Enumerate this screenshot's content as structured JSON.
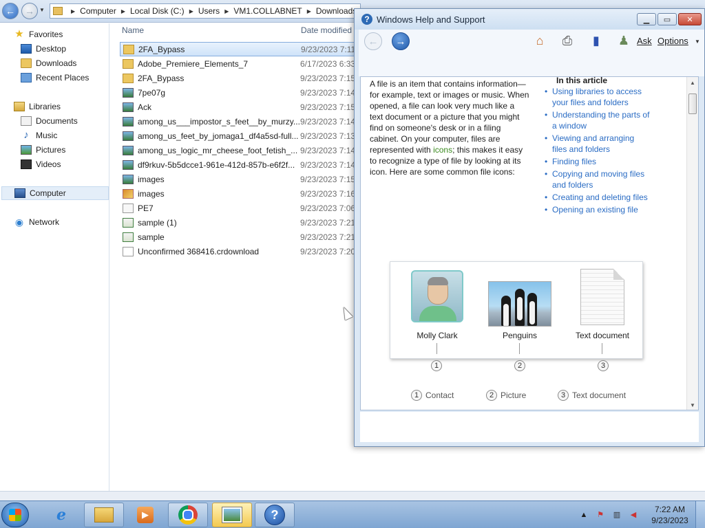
{
  "explorer": {
    "breadcrumbs": [
      "Computer",
      "Local Disk (C:)",
      "Users",
      "VM1.COLLABNET",
      "Downloads"
    ],
    "columns": {
      "name": "Name",
      "date_modified": "Date modified"
    },
    "nav": {
      "favorites": "Favorites",
      "desktop": "Desktop",
      "downloads": "Downloads",
      "recent_places": "Recent Places",
      "libraries": "Libraries",
      "documents": "Documents",
      "music": "Music",
      "pictures": "Pictures",
      "videos": "Videos",
      "computer": "Computer",
      "network": "Network"
    },
    "files": [
      {
        "name": "2FA_Bypass",
        "date": "9/23/2023 7:11",
        "icon": "folder-icon",
        "selected": true
      },
      {
        "name": "Adobe_Premiere_Elements_7",
        "date": "6/17/2023 6:33",
        "icon": "folder-icon"
      },
      {
        "name": "2FA_Bypass",
        "date": "9/23/2023 7:15",
        "icon": "folder-icon"
      },
      {
        "name": "7pe07g",
        "date": "9/23/2023 7:14",
        "icon": "image-file-icon"
      },
      {
        "name": "Ack",
        "date": "9/23/2023 7:15",
        "icon": "image-file-icon"
      },
      {
        "name": "among_us___impostor_s_feet__by_murzy...",
        "date": "9/23/2023 7:14",
        "icon": "image-file-icon"
      },
      {
        "name": "among_us_feet_by_jomaga1_df4a5sd-full...",
        "date": "9/23/2023 7:13",
        "icon": "image-file-icon"
      },
      {
        "name": "among_us_logic_mr_cheese_foot_fetish_...",
        "date": "9/23/2023 7:14",
        "icon": "image-file-icon"
      },
      {
        "name": "df9rkuv-5b5dcce1-961e-412d-857b-e6f2f...",
        "date": "9/23/2023 7:14",
        "icon": "image-file-icon"
      },
      {
        "name": "images",
        "date": "9/23/2023 7:15",
        "icon": "image-file-icon"
      },
      {
        "name": "images",
        "date": "9/23/2023 7:16",
        "icon": "jpeg-file-icon"
      },
      {
        "name": "PE7",
        "date": "9/23/2023 7:06",
        "icon": "executable-file-icon"
      },
      {
        "name": "sample (1)",
        "date": "9/23/2023 7:21",
        "icon": "script-file-icon"
      },
      {
        "name": "sample",
        "date": "9/23/2023 7:21",
        "icon": "script-file-icon"
      },
      {
        "name": "Unconfirmed 368416.crdownload",
        "date": "9/23/2023 7:20",
        "icon": "blank-file-icon"
      }
    ]
  },
  "help": {
    "title": "Windows Help and Support",
    "toolbar": {
      "ask": "Ask",
      "options": "Options"
    },
    "body_text": {
      "before_link": "A file is an item that contains information—for example, text or images or music. When opened, a file can look very much like a text document or a picture that you might find on someone's desk or in a filing cabinet. On your computer, files are represented with ",
      "link": "icons",
      "after_link": "; this makes it easy to recognize a type of file by looking at its icon. Here are some common file icons:"
    },
    "article_heading": "In this article",
    "article_links": [
      "Using libraries to access your files and folders",
      "Understanding the parts of a window",
      "Viewing and arranging files and folders",
      "Finding files",
      "Copying and moving files and folders",
      "Creating and deleting files",
      "Opening an existing file"
    ],
    "figure": {
      "captions": [
        "Molly Clark",
        "Penguins",
        "Text document"
      ],
      "callouts": [
        "1",
        "2",
        "3"
      ],
      "legend": [
        "Contact",
        "Picture",
        "Text document"
      ]
    }
  },
  "taskbar": {
    "clock_time": "7:22 AM",
    "clock_date": "9/23/2023",
    "apps": [
      "internet-explorer-icon",
      "windows-explorer-icon",
      "media-player-icon",
      "chrome-icon",
      "photo-viewer-icon",
      "help-and-support-icon"
    ]
  }
}
